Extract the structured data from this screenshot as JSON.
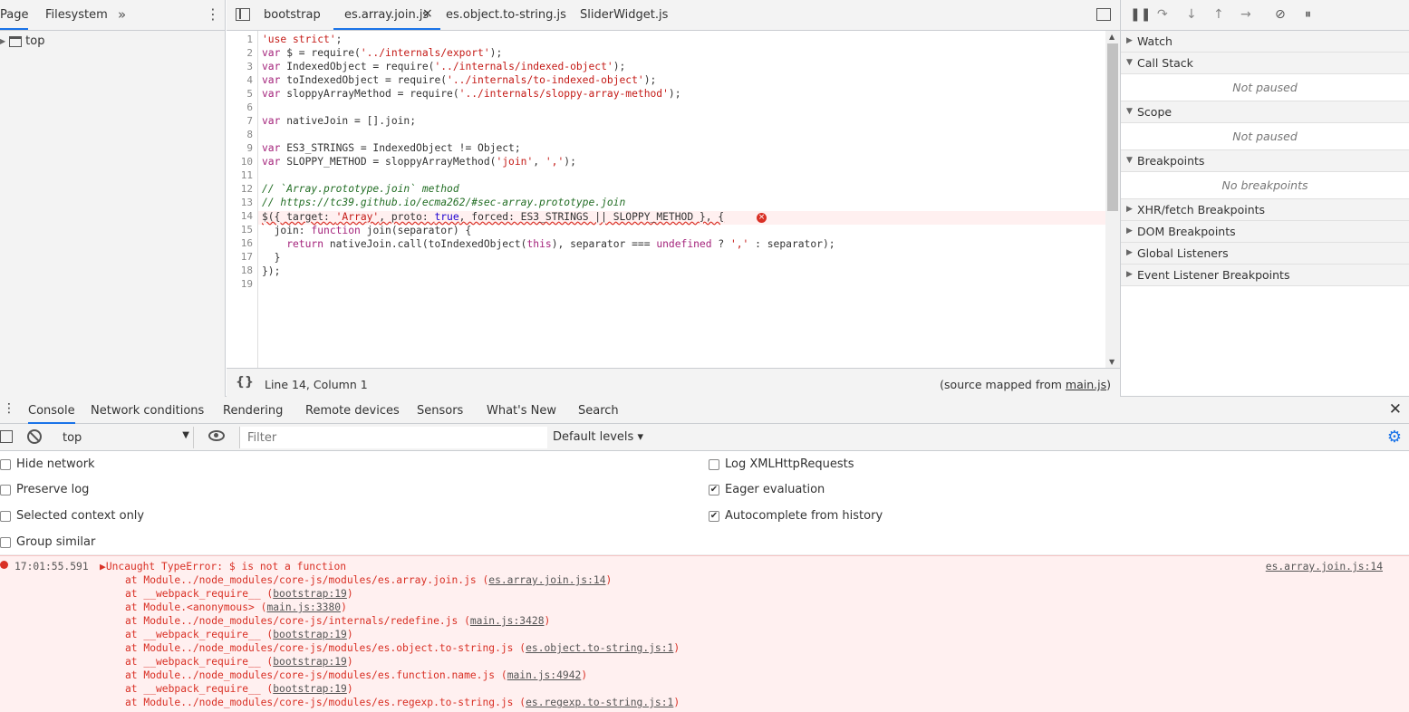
{
  "navigator": {
    "tabs": [
      "Page",
      "Filesystem"
    ],
    "more": "»",
    "tree_item": "top"
  },
  "editor": {
    "tabs": [
      {
        "label": "bootstrap"
      },
      {
        "label": "es.array.join.js",
        "close": "×"
      },
      {
        "label": "es.object.to-string.js"
      },
      {
        "label": "SliderWidget.js"
      }
    ],
    "line_numbers": [
      "1",
      "2",
      "3",
      "4",
      "5",
      "6",
      "7",
      "8",
      "9",
      "10",
      "11",
      "12",
      "13",
      "14",
      "15",
      "16",
      "17",
      "18",
      "19"
    ],
    "status": {
      "braces": "{}",
      "cursor": "Line 14, Column 1",
      "source_mapped_prefix": "(source mapped from ",
      "source_mapped_link": "main.js",
      "source_mapped_suffix": ")"
    }
  },
  "debugger": {
    "sections": [
      {
        "label": "Watch"
      },
      {
        "label": "Call Stack",
        "body": "Not paused"
      },
      {
        "label": "Scope",
        "body": "Not paused"
      },
      {
        "label": "Breakpoints",
        "body": "No breakpoints"
      },
      {
        "label": "XHR/fetch Breakpoints"
      },
      {
        "label": "DOM Breakpoints"
      },
      {
        "label": "Global Listeners"
      },
      {
        "label": "Event Listener Breakpoints"
      }
    ]
  },
  "drawer": {
    "tabs": [
      "Console",
      "Network conditions",
      "Rendering",
      "Remote devices",
      "Sensors",
      "What's New",
      "Search"
    ],
    "context": "top",
    "filter_placeholder": "Filter",
    "levels": "Default levels ▾",
    "settings": {
      "left": [
        {
          "label": "Hide network",
          "checked": false
        },
        {
          "label": "Preserve log",
          "checked": false
        },
        {
          "label": "Selected context only",
          "checked": false
        },
        {
          "label": "Group similar",
          "checked": false
        }
      ],
      "right": [
        {
          "label": "Log XMLHttpRequests",
          "checked": false
        },
        {
          "label": "Eager evaluation",
          "checked": true
        },
        {
          "label": "Autocomplete from history",
          "checked": true
        }
      ]
    },
    "error": {
      "time": "17:01:55.591",
      "message": "Uncaught TypeError: $ is not a function",
      "source": "es.array.join.js:14",
      "stack": [
        {
          "text": "at Module../node_modules/core-js/modules/es.array.join.js (",
          "link": "es.array.join.js:14"
        },
        {
          "text": "at __webpack_require__ (",
          "link": "bootstrap:19"
        },
        {
          "text": "at Module.<anonymous> (",
          "link": "main.js:3380"
        },
        {
          "text": "at Module../node_modules/core-js/internals/redefine.js (",
          "link": "main.js:3428"
        },
        {
          "text": "at __webpack_require__ (",
          "link": "bootstrap:19"
        },
        {
          "text": "at Module../node_modules/core-js/modules/es.object.to-string.js (",
          "link": "es.object.to-string.js:1"
        },
        {
          "text": "at __webpack_require__ (",
          "link": "bootstrap:19"
        },
        {
          "text": "at Module../node_modules/core-js/modules/es.function.name.js (",
          "link": "main.js:4942"
        },
        {
          "text": "at __webpack_require__ (",
          "link": "bootstrap:19"
        },
        {
          "text": "at Module../node_modules/core-js/modules/es.regexp.to-string.js (",
          "link": "es.regexp.to-string.js:1"
        }
      ]
    }
  },
  "code": {
    "l1a": "'use strict'",
    "l1b": ";",
    "l2a": "var",
    "l2b": " $ = require(",
    "l2c": "'../internals/export'",
    "l2d": ");",
    "l3a": "var",
    "l3b": " IndexedObject = require(",
    "l3c": "'../internals/indexed-object'",
    "l3d": ");",
    "l4a": "var",
    "l4b": " toIndexedObject = require(",
    "l4c": "'../internals/to-indexed-object'",
    "l4d": ");",
    "l5a": "var",
    "l5b": " sloppyArrayMethod = require(",
    "l5c": "'../internals/sloppy-array-method'",
    "l5d": ");",
    "l7a": "var",
    "l7b": " nativeJoin = [].join;",
    "l9a": "var",
    "l9b": " ES3_STRINGS = IndexedObject != Object;",
    "l10a": "var",
    "l10b": " SLOPPY_METHOD = sloppyArrayMethod(",
    "l10c": "'join'",
    "l10d": ", ",
    "l10e": "','",
    "l10f": ");",
    "l12": "// `Array.prototype.join` method",
    "l13": "// https://tc39.github.io/ecma262/#sec-array.prototype.join",
    "l14a": "$({ target: ",
    "l14b": "'Array'",
    "l14c": ", proto: ",
    "l14d": "true",
    "l14e": ", forced: ES3_STRINGS || SLOPPY_METHOD }, {",
    "l15a": "  join: ",
    "l15b": "function",
    "l15c": " join(separator) {",
    "l16a": "    return",
    "l16b": " nativeJoin.call(toIndexedObject(",
    "l16c": "this",
    "l16d": "), separator === ",
    "l16e": "undefined",
    "l16f": " ? ",
    "l16g": "','",
    "l16h": " : separator);",
    "l17": "  }",
    "l18": "});",
    "err_glyph": "×"
  }
}
